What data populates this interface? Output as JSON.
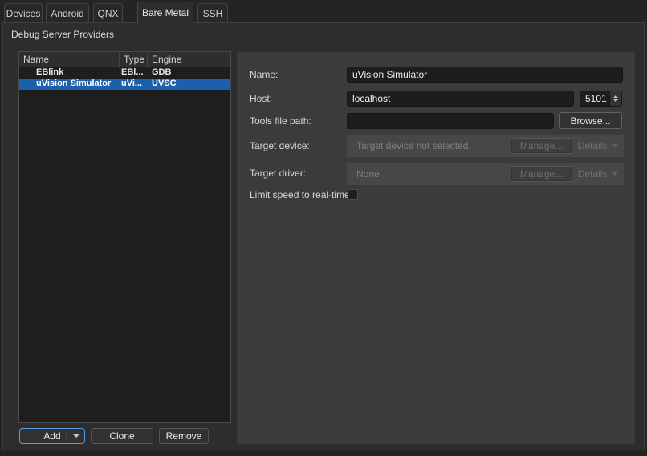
{
  "tabs": [
    {
      "label": "Devices",
      "active": false
    },
    {
      "label": "Android",
      "active": false
    },
    {
      "label": "QNX",
      "active": false
    },
    {
      "label": "Bare Metal",
      "active": true
    },
    {
      "label": "SSH",
      "active": false
    }
  ],
  "section_title": "Debug Server Providers",
  "providers_table": {
    "columns": [
      "Name",
      "Type",
      "Engine"
    ],
    "rows": [
      {
        "name": "EBlink",
        "type": "EBl...",
        "engine": "GDB",
        "selected": false
      },
      {
        "name": "uVision Simulator",
        "type": "uVi...",
        "engine": "UVSC",
        "selected": true
      }
    ]
  },
  "list_buttons": {
    "add": "Add",
    "clone": "Clone",
    "remove": "Remove"
  },
  "form": {
    "name": {
      "label": "Name:",
      "value": "uVision Simulator"
    },
    "host": {
      "label": "Host:",
      "value": "localhost",
      "port": "5101"
    },
    "tools_file_path": {
      "label": "Tools file path:",
      "value": "",
      "browse_label": "Browse..."
    },
    "target_device": {
      "label": "Target device:",
      "placeholder": "Target device not selected.",
      "manage_label": "Manage...",
      "details_label": "Details"
    },
    "target_driver": {
      "label": "Target driver:",
      "value": "None",
      "manage_label": "Manage...",
      "details_label": "Details"
    },
    "limit_speed": {
      "label": "Limit speed to real-time:",
      "checked": false
    }
  },
  "colors": {
    "selection_blue": "#1c5fad",
    "focus_outline_blue": "#55a0e8",
    "panel_bg": "#3b3b3b",
    "disabled_field_bg": "#474747",
    "table_bg": "#1e1e1e",
    "pane_bg": "#2d2d2d"
  }
}
